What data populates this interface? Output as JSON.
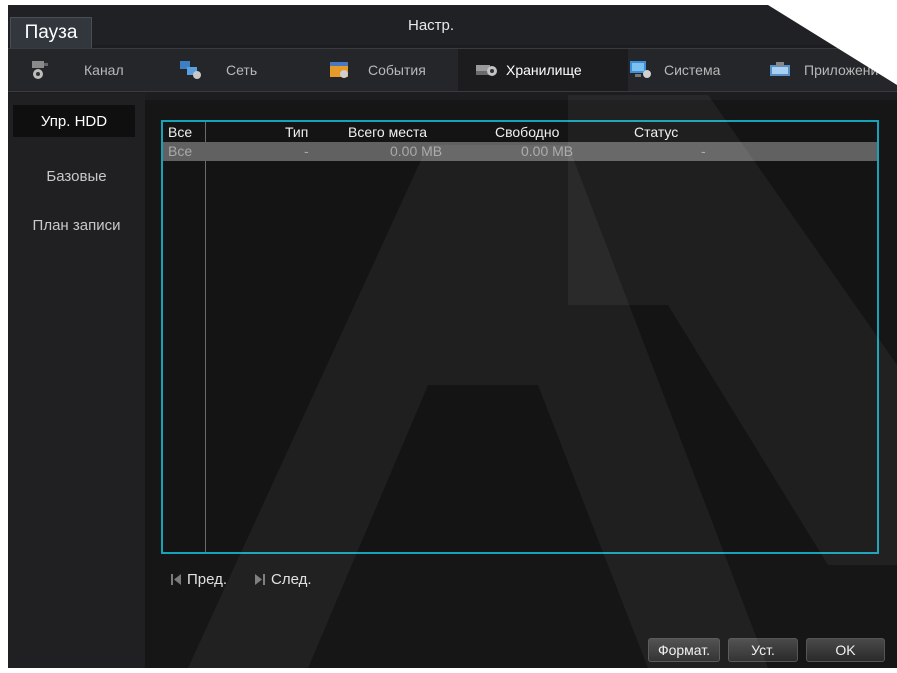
{
  "title_bar": {
    "pause_label": "Пауза",
    "title": "Настр."
  },
  "tabs": [
    {
      "label": "Канал",
      "icon": "camera-gear-icon",
      "active": false
    },
    {
      "label": "Сеть",
      "icon": "network-gear-icon",
      "active": false
    },
    {
      "label": "События",
      "icon": "events-gear-icon",
      "active": false
    },
    {
      "label": "Хранилище",
      "icon": "storage-gear-icon",
      "active": true
    },
    {
      "label": "Система",
      "icon": "system-gear-icon",
      "active": false
    },
    {
      "label": "Приложени",
      "icon": "app-gear-icon",
      "active": false
    }
  ],
  "sidebar": {
    "items": [
      {
        "label": "Упр. HDD",
        "active": true
      },
      {
        "label": "Базовые",
        "active": false
      },
      {
        "label": "План записи",
        "active": false
      }
    ]
  },
  "table": {
    "headers": [
      "Все",
      "Тип",
      "Всего места",
      "Свободно",
      "Статус"
    ],
    "rows": [
      {
        "all": "Все",
        "type": "-",
        "total": "0.00 MB",
        "free": "0.00 MB",
        "status": "-"
      }
    ]
  },
  "pager": {
    "prev_label": "Пред.",
    "next_label": "След."
  },
  "buttons": {
    "format_label": "Формат.",
    "set_label": "Уст.",
    "ok_label": "OK"
  },
  "colors": {
    "table_border": "#16a2b8",
    "selected_row": "#616161",
    "background": "#1d1d1f"
  }
}
